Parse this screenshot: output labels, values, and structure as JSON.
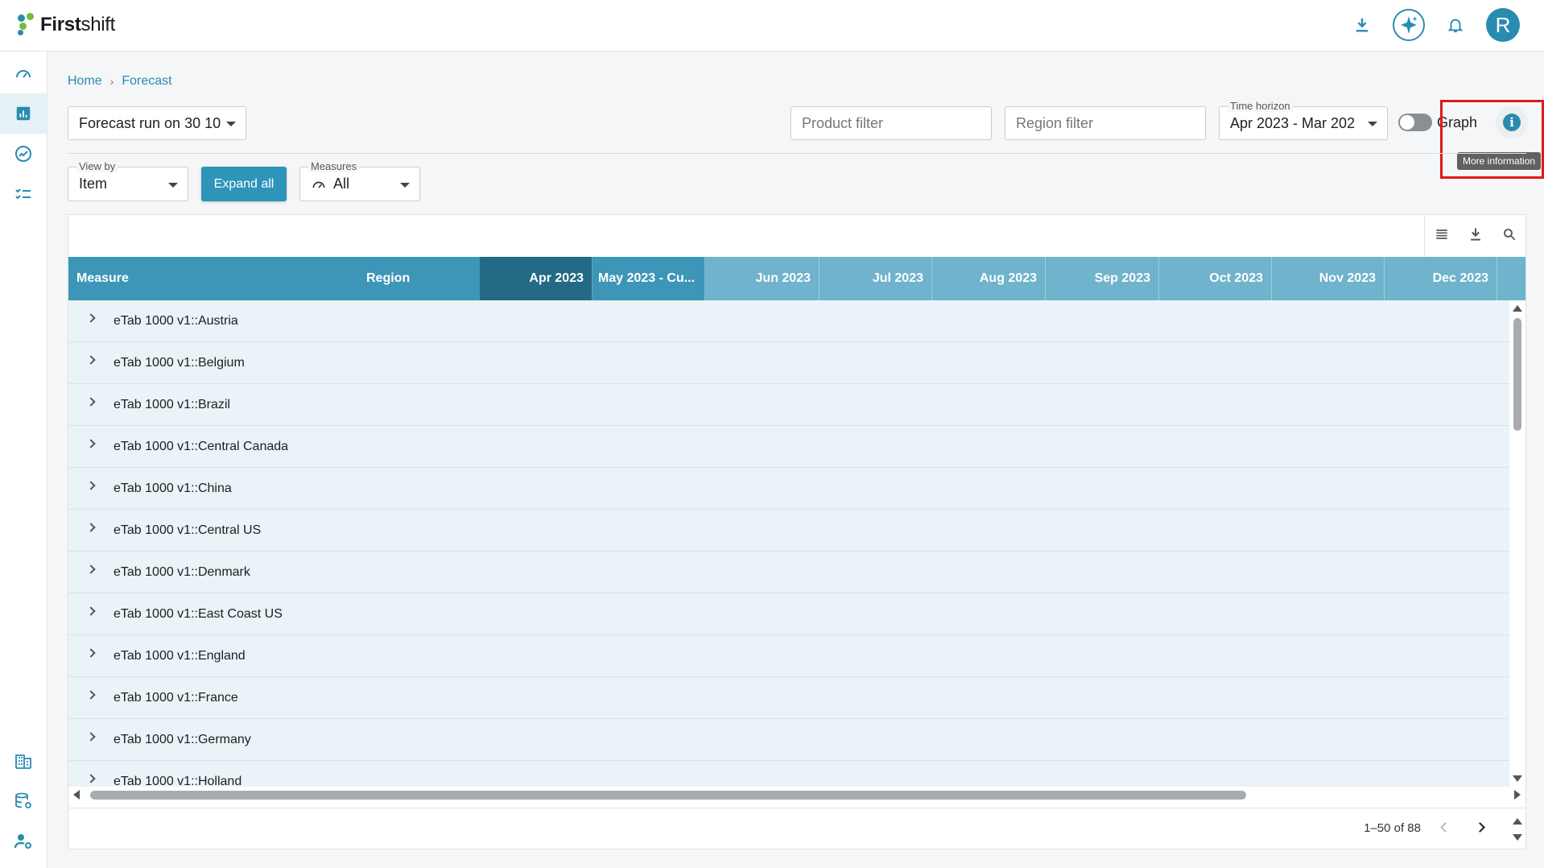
{
  "app": {
    "brand_bold": "First",
    "brand_rest": "shift"
  },
  "header": {
    "avatar_initial": "R"
  },
  "breadcrumb": {
    "home": "Home",
    "separator": "›",
    "current": "Forecast"
  },
  "forecast_run": {
    "value": "Forecast run on 30 10"
  },
  "filters": {
    "product_placeholder": "Product filter",
    "region_placeholder": "Region filter",
    "time_horizon_label": "Time horizon",
    "time_horizon_value": "Apr 2023 - Mar 202"
  },
  "graph_toggle": {
    "label": "Graph",
    "on": false
  },
  "info": {
    "tooltip": "More information"
  },
  "view_by": {
    "label": "View by",
    "value": "Item"
  },
  "expand_all": {
    "label": "Expand all"
  },
  "measures": {
    "label": "Measures",
    "value": "All"
  },
  "table": {
    "columns": {
      "measure": "Measure",
      "region": "Region",
      "months": [
        "Apr 2023",
        "May 2023 - Cu...",
        "Jun 2023",
        "Jul 2023",
        "Aug 2023",
        "Sep 2023",
        "Oct 2023",
        "Nov 2023",
        "Dec 2023"
      ]
    },
    "rows": [
      "eTab 1000 v1::Austria",
      "eTab 1000 v1::Belgium",
      "eTab 1000 v1::Brazil",
      "eTab 1000 v1::Central Canada",
      "eTab 1000 v1::China",
      "eTab 1000 v1::Central US",
      "eTab 1000 v1::Denmark",
      "eTab 1000 v1::East Coast US",
      "eTab 1000 v1::England",
      "eTab 1000 v1::France",
      "eTab 1000 v1::Germany",
      "eTab 1000 v1::Holland"
    ]
  },
  "pagination": {
    "text": "1–50 of 88"
  },
  "colors": {
    "accent": "#2a8bb0",
    "header_dark": "#236a84",
    "header_mid": "#3d96b8",
    "header_light": "#6fb3cc",
    "row_bg": "#eaf3f7",
    "highlight": "#e01919"
  },
  "icons": {
    "nav": [
      "dashboard-icon",
      "bar-chart-icon",
      "trend-icon",
      "checklist-icon",
      "building-icon",
      "database-settings-icon",
      "user-settings-icon"
    ],
    "top": [
      "download-icon",
      "ai-sparkle-icon",
      "bell-icon"
    ],
    "table_tools": [
      "columns-menu-icon",
      "download-icon",
      "search-icon"
    ]
  }
}
